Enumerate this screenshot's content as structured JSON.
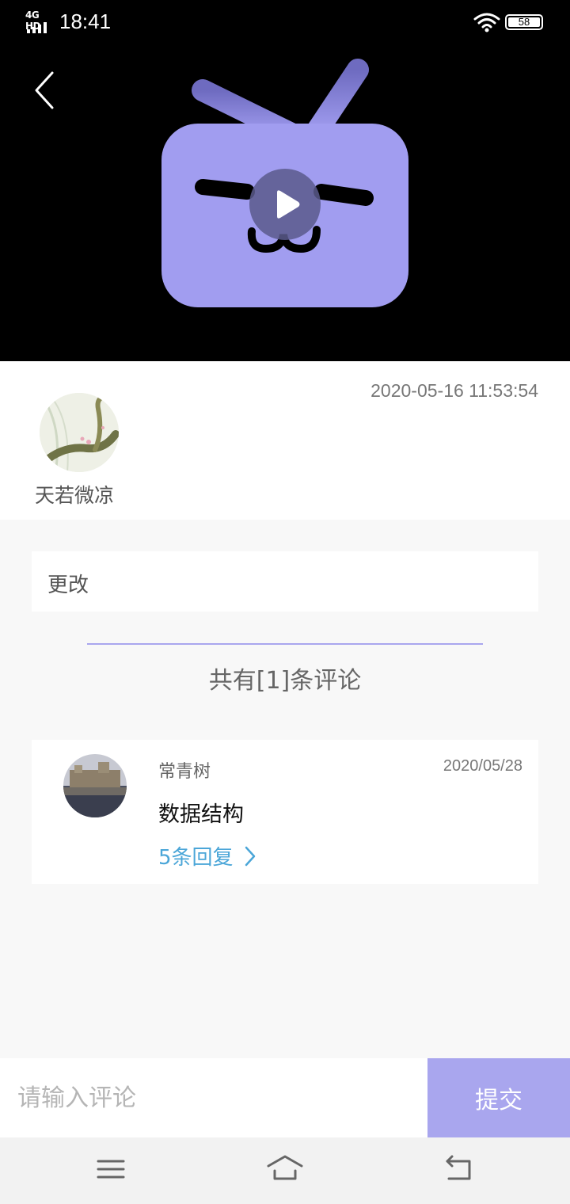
{
  "status_bar": {
    "network": "4G HD",
    "time": "18:41",
    "battery": "58"
  },
  "video": {
    "logo_color": "#a19df0"
  },
  "author": {
    "date": "2020-05-16 11:53:54",
    "name": "天若微凉"
  },
  "content": {
    "text": "更改"
  },
  "comments_header": "共有[1]条评论",
  "comments": [
    {
      "name": "常青树",
      "date": "2020/05/28",
      "text": "数据结构",
      "replies": "5条回复"
    }
  ],
  "input": {
    "placeholder": "请输入评论",
    "submit_label": "提交"
  },
  "colors": {
    "accent": "#a9a6ee",
    "link": "#4ba6d8"
  }
}
